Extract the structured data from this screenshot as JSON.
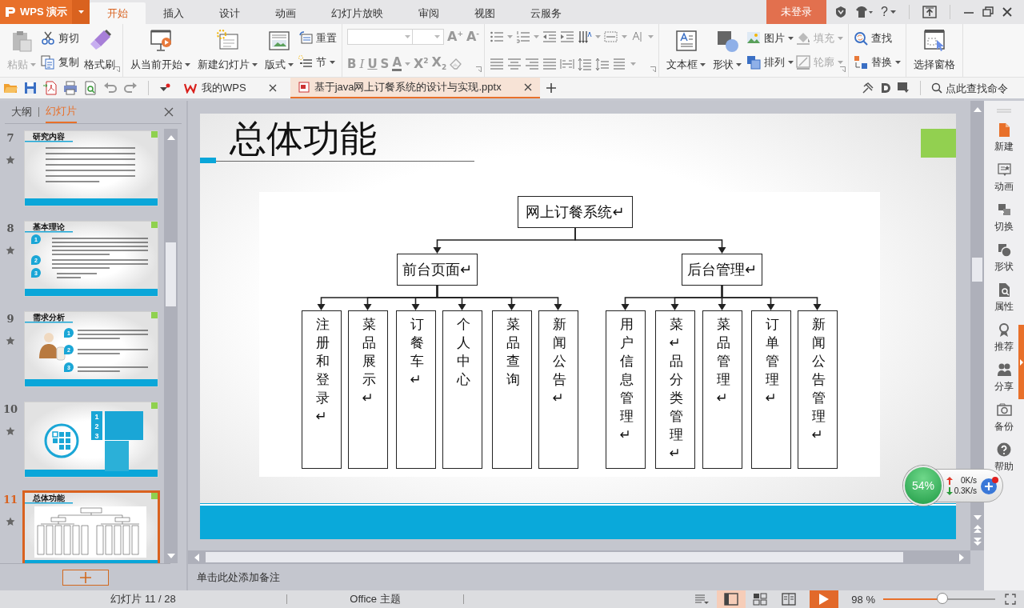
{
  "app": {
    "logo": "WPS 演示",
    "tabs": [
      {
        "label": "开始",
        "selected": true
      },
      {
        "label": "插入",
        "selected": false
      },
      {
        "label": "设计",
        "selected": false
      },
      {
        "label": "动画",
        "selected": false
      },
      {
        "label": "幻灯片放映",
        "selected": false
      },
      {
        "label": "审阅",
        "selected": false
      },
      {
        "label": "视图",
        "selected": false
      },
      {
        "label": "云服务",
        "selected": false
      }
    ],
    "login": "未登录",
    "help": "?"
  },
  "ribbon": [
    {
      "kind": "buttons",
      "launcher": true,
      "columns": [
        {
          "kind": "large",
          "label": "粘贴",
          "dropdown": true,
          "disabled": true
        },
        {
          "kind": "stack",
          "items": [
            {
              "label": "剪切",
              "dropdown": false,
              "disabled": false
            },
            {
              "label": "复制",
              "dropdown": false,
              "disabled": false
            }
          ]
        },
        {
          "kind": "large",
          "label": "格式刷",
          "dropdown": false,
          "disabled": false
        }
      ]
    },
    {
      "kind": "buttons",
      "launcher": false,
      "columns": [
        {
          "kind": "large",
          "label": "从当前开始",
          "dropdown": true,
          "disabled": false
        },
        {
          "kind": "large",
          "label": "新建幻灯片",
          "dropdown": true,
          "disabled": false
        },
        {
          "kind": "large",
          "label": "版式",
          "dropdown": true,
          "disabled": false
        },
        {
          "kind": "stack",
          "items": [
            {
              "label": "重置",
              "dropdown": false,
              "disabled": false
            },
            {
              "label": "节",
              "dropdown": true,
              "disabled": false
            }
          ]
        }
      ]
    },
    {
      "kind": "font",
      "launcher": true,
      "size_buttons": [
        "A$^{+}$",
        "A$^{-}$"
      ],
      "styles": [
        "B",
        "I",
        "U",
        "S",
        "A"
      ],
      "scripts": [
        "X$^{2}$",
        "X$_{2}$"
      ]
    },
    {
      "kind": "paragraph",
      "launcher": true
    },
    {
      "kind": "buttons",
      "launcher": true,
      "columns": [
        {
          "kind": "large",
          "label": "文本框",
          "dropdown": true,
          "disabled": false
        },
        {
          "kind": "large",
          "label": "形状",
          "dropdown": true,
          "disabled": false
        },
        {
          "kind": "stack",
          "items": [
            {
              "label": "图片",
              "dropdown": true,
              "disabled": false
            },
            {
              "label": "排列",
              "dropdown": true,
              "disabled": false
            }
          ]
        },
        {
          "kind": "stack",
          "items": [
            {
              "label": "填充",
              "dropdown": true,
              "disabled": true
            },
            {
              "label": "轮廓",
              "dropdown": true,
              "disabled": true
            }
          ]
        }
      ]
    },
    {
      "kind": "buttons",
      "launcher": false,
      "columns": [
        {
          "kind": "stack",
          "items": [
            {
              "label": "查找",
              "dropdown": false,
              "disabled": false
            },
            {
              "label": "替换",
              "dropdown": true,
              "disabled": false
            }
          ]
        }
      ]
    },
    {
      "kind": "buttons",
      "launcher": false,
      "columns": [
        {
          "kind": "large",
          "label": "选择窗格",
          "dropdown": false,
          "disabled": false
        }
      ]
    }
  ],
  "document_tabs": [
    {
      "label": "我的WPS",
      "selected": false
    },
    {
      "label": "基于java网上订餐系统的设计与实现.pptx",
      "selected": true
    }
  ],
  "command_search": {
    "placeholder": "点此查找命令"
  },
  "left_panel": {
    "tabs": [
      {
        "label": "大纲",
        "selected": false
      },
      {
        "label": "幻灯片",
        "selected": true
      }
    ],
    "thumbnails": [
      {
        "number": "7",
        "kind": "text",
        "title": "研究内容",
        "selected": false
      },
      {
        "number": "8",
        "kind": "numbered",
        "title": "基本理论",
        "markers": [
          "1",
          "2",
          "3"
        ],
        "selected": false
      },
      {
        "number": "9",
        "kind": "figure",
        "title": "需求分析",
        "markers": [
          "1",
          "2",
          "3"
        ],
        "selected": false
      },
      {
        "number": "10",
        "kind": "menu",
        "markers": [
          "1",
          "2",
          "3"
        ],
        "selected": false
      },
      {
        "number": "11",
        "kind": "diagram",
        "title": "总体功能",
        "selected": true
      }
    ]
  },
  "slide": {
    "title": "总体功能",
    "diagram": {
      "label": "网上订餐系统↵",
      "children": [
        {
          "label": "前台页面↵",
          "children": [
            {
              "label": "注册和登录↵"
            },
            {
              "label": "菜品展示↵"
            },
            {
              "label": "订餐车↵"
            },
            {
              "label": "个人中心"
            },
            {
              "label": "菜品查询"
            },
            {
              "label": "新闻公告↵"
            }
          ]
        },
        {
          "label": "后台管理↵",
          "children": [
            {
              "label": "用户信息管理↵"
            },
            {
              "label": "菜↵品分类管理↵"
            },
            {
              "label": "菜品管理↵"
            },
            {
              "label": "订单管理↵"
            },
            {
              "label": "新闻公告管理↵"
            }
          ]
        }
      ]
    }
  },
  "notes": {
    "placeholder": "单击此处添加备注"
  },
  "task_pane": [
    "新建",
    "动画",
    "切换",
    "形状",
    "属性",
    "推荐",
    "分享",
    "备份",
    "帮助"
  ],
  "network_monitor": {
    "percent": "54%",
    "upload": "0K/s",
    "download": "0.3K/s"
  },
  "status_bar": {
    "slide_info": "幻灯片 11 / 28",
    "theme": "Office 主题",
    "views": [
      {
        "selected": true
      },
      {
        "selected": false
      },
      {
        "selected": false
      }
    ],
    "zoom": "98 %",
    "zoom_slider": {
      "level": 0.53
    }
  }
}
